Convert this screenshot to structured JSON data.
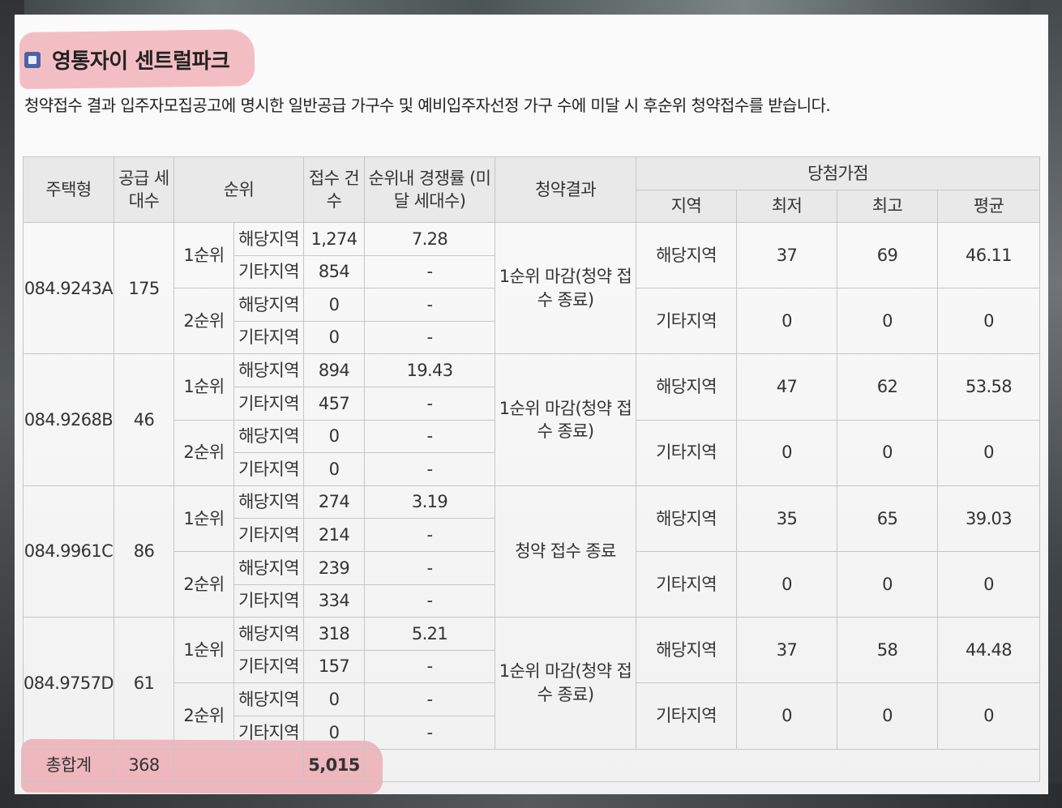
{
  "title": "영통자이 센트럴파크",
  "notice": "청약접수 결과 입주자모집공고에 명시한 일반공급 가구수 및 예비입주자선정 가구 수에 미달 시 후순위 청약접수를 받습니다.",
  "headers": {
    "house_type": "주택형",
    "supply_units": "공급 세대수",
    "rank": "순위",
    "applications": "접수 건수",
    "competition": "순위내 경쟁률 (미달 세대수)",
    "result": "청약결과",
    "winning_score": "당첨가점",
    "region": "지역",
    "min": "최저",
    "max": "최고",
    "avg": "평균"
  },
  "units": [
    {
      "type": "084.9243A",
      "supply": "175",
      "result": "1순위 마감(청약 접수 종료)",
      "ranks": [
        {
          "rank": "1순위",
          "rows": [
            {
              "area": "해당지역",
              "count": "1,274",
              "rate": "7.28"
            },
            {
              "area": "기타지역",
              "count": "854",
              "rate": "-"
            }
          ]
        },
        {
          "rank": "2순위",
          "rows": [
            {
              "area": "해당지역",
              "count": "0",
              "rate": "-"
            },
            {
              "area": "기타지역",
              "count": "0",
              "rate": "-"
            }
          ]
        }
      ],
      "scores": [
        {
          "region": "해당지역",
          "min": "37",
          "max": "69",
          "avg": "46.11"
        },
        {
          "region": "기타지역",
          "min": "0",
          "max": "0",
          "avg": "0"
        }
      ]
    },
    {
      "type": "084.9268B",
      "supply": "46",
      "result": "1순위 마감(청약 접수 종료)",
      "ranks": [
        {
          "rank": "1순위",
          "rows": [
            {
              "area": "해당지역",
              "count": "894",
              "rate": "19.43"
            },
            {
              "area": "기타지역",
              "count": "457",
              "rate": "-"
            }
          ]
        },
        {
          "rank": "2순위",
          "rows": [
            {
              "area": "해당지역",
              "count": "0",
              "rate": "-"
            },
            {
              "area": "기타지역",
              "count": "0",
              "rate": "-"
            }
          ]
        }
      ],
      "scores": [
        {
          "region": "해당지역",
          "min": "47",
          "max": "62",
          "avg": "53.58"
        },
        {
          "region": "기타지역",
          "min": "0",
          "max": "0",
          "avg": "0"
        }
      ]
    },
    {
      "type": "084.9961C",
      "supply": "86",
      "result": "청약 접수 종료",
      "ranks": [
        {
          "rank": "1순위",
          "rows": [
            {
              "area": "해당지역",
              "count": "274",
              "rate": "3.19"
            },
            {
              "area": "기타지역",
              "count": "214",
              "rate": "-"
            }
          ]
        },
        {
          "rank": "2순위",
          "rows": [
            {
              "area": "해당지역",
              "count": "239",
              "rate": "-"
            },
            {
              "area": "기타지역",
              "count": "334",
              "rate": "-"
            }
          ]
        }
      ],
      "scores": [
        {
          "region": "해당지역",
          "min": "35",
          "max": "65",
          "avg": "39.03"
        },
        {
          "region": "기타지역",
          "min": "0",
          "max": "0",
          "avg": "0"
        }
      ]
    },
    {
      "type": "084.9757D",
      "supply": "61",
      "result": "1순위 마감(청약 접수 종료)",
      "ranks": [
        {
          "rank": "1순위",
          "rows": [
            {
              "area": "해당지역",
              "count": "318",
              "rate": "5.21"
            },
            {
              "area": "기타지역",
              "count": "157",
              "rate": "-"
            }
          ]
        },
        {
          "rank": "2순위",
          "rows": [
            {
              "area": "해당지역",
              "count": "0",
              "rate": "-"
            },
            {
              "area": "기타지역",
              "count": "0",
              "rate": "-"
            }
          ]
        }
      ],
      "scores": [
        {
          "region": "해당지역",
          "min": "37",
          "max": "58",
          "avg": "44.48"
        },
        {
          "region": "기타지역",
          "min": "0",
          "max": "0",
          "avg": "0"
        }
      ]
    }
  ],
  "total": {
    "label": "총합계",
    "supply": "368",
    "applications": "5,015"
  }
}
